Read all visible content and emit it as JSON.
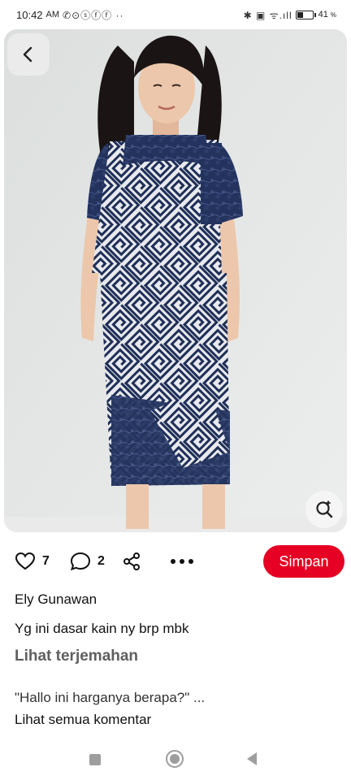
{
  "status_bar": {
    "time": "10:42",
    "ampm": "AM",
    "notification_icons": "✆⊙ⓢⓕⓕ ··",
    "network_icons": "✱ ▣ ᯤ.ıll",
    "battery_percent": "41",
    "battery_level": 0.41,
    "battery_suffix": "%"
  },
  "pin": {
    "image_description_icon": "photo",
    "colors": {
      "background": "#e4e6e5",
      "fabric_navy": "#1f2f57",
      "fabric_light": "#e8e9ee",
      "skin": "#e9c2a6",
      "hair": "#1a1414"
    }
  },
  "actions": {
    "like_count": "7",
    "comment_count": "2",
    "save_label": "Simpan",
    "accent_color": "#e60023"
  },
  "comment": {
    "author": "Ely Gunawan",
    "text": "Yg ini dasar kain ny brp mbk",
    "translate_label": "Lihat terjemahan"
  },
  "more_comments": {
    "preview": "\"Hallo ini harganya berapa?\" ...",
    "view_all_label": "Lihat semua komentar"
  },
  "icons": {
    "back": "chevron-left-icon",
    "visual_search": "lens-search-icon",
    "like": "heart-icon",
    "comment": "speech-bubble-icon",
    "share": "share-icon",
    "more": "ellipsis-icon"
  }
}
